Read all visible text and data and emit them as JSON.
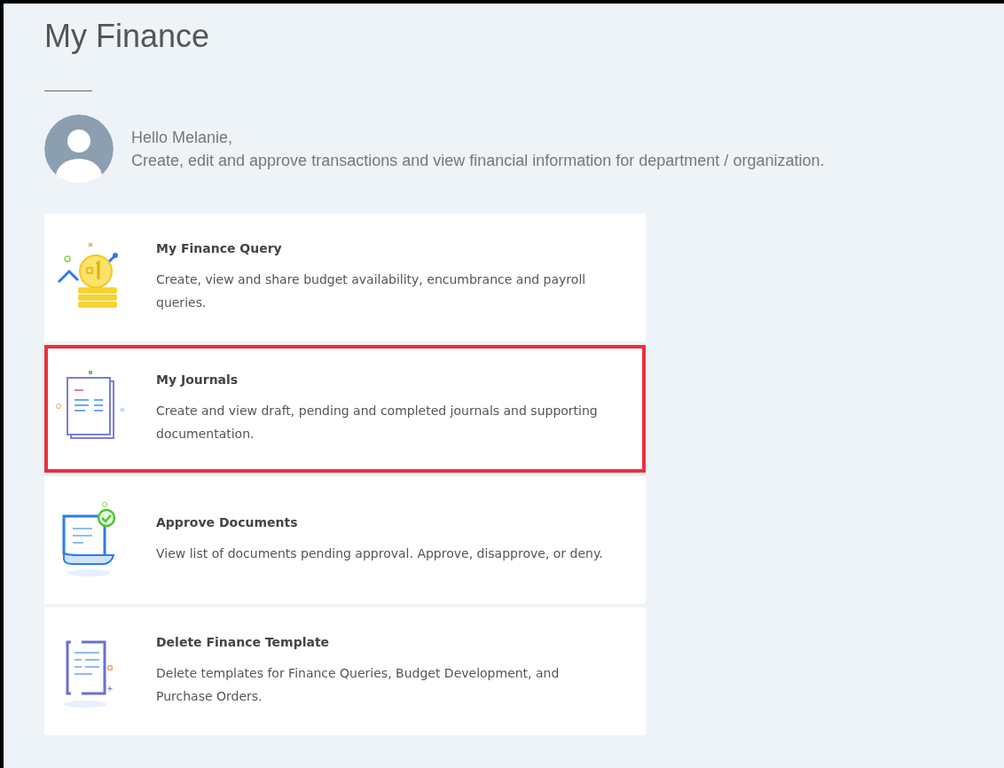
{
  "page_title": "My Finance",
  "greeting": {
    "hello": "Hello Melanie,",
    "message": "Create, edit and approve transactions and view financial information for department / organization."
  },
  "cards": [
    {
      "kind": "query",
      "title": "My Finance Query",
      "description": "Create, view and share budget availability, encumbrance and payroll queries.",
      "highlighted": false
    },
    {
      "kind": "journals",
      "title": "My Journals",
      "description": "Create and view draft, pending and completed journals and supporting documentation.",
      "highlighted": true
    },
    {
      "kind": "approve",
      "title": "Approve Documents",
      "description": "View list of documents pending approval. Approve, disapprove, or deny.",
      "highlighted": false
    },
    {
      "kind": "template",
      "title": "Delete Finance Template",
      "description": "Delete templates for Finance Queries, Budget Development, and Purchase Orders.",
      "highlighted": false
    }
  ]
}
